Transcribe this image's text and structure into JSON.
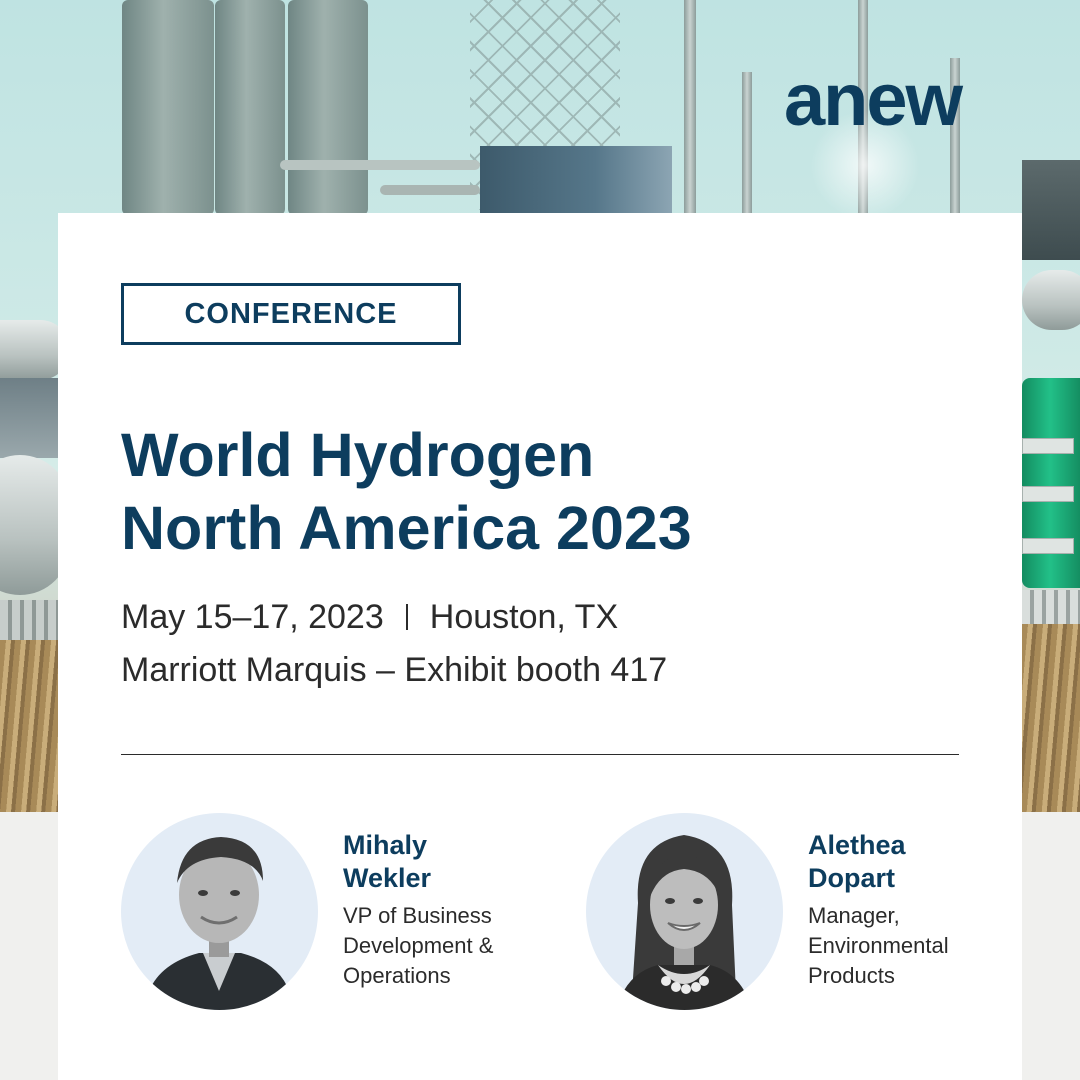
{
  "brand": {
    "logo_text": "anew",
    "color_primary": "#0d3d5e",
    "color_text": "#2b2b2b"
  },
  "event": {
    "category": "CONFERENCE",
    "title_line1": "World Hydrogen",
    "title_line2": "North America 2023",
    "dates": "May 15–17, 2023",
    "city": "Houston, TX",
    "venue": "Marriott Marquis – Exhibit booth 417"
  },
  "speakers": [
    {
      "first_name": "Mihaly",
      "last_name": "Wekler",
      "role_lines": [
        "VP of Business",
        "Development &",
        "Operations"
      ],
      "avatar_icon": "portrait-man-photo"
    },
    {
      "first_name": "Alethea",
      "last_name": "Dopart",
      "role_lines": [
        "Manager,",
        "Environmental",
        "Products"
      ],
      "avatar_icon": "portrait-woman-photo"
    }
  ]
}
